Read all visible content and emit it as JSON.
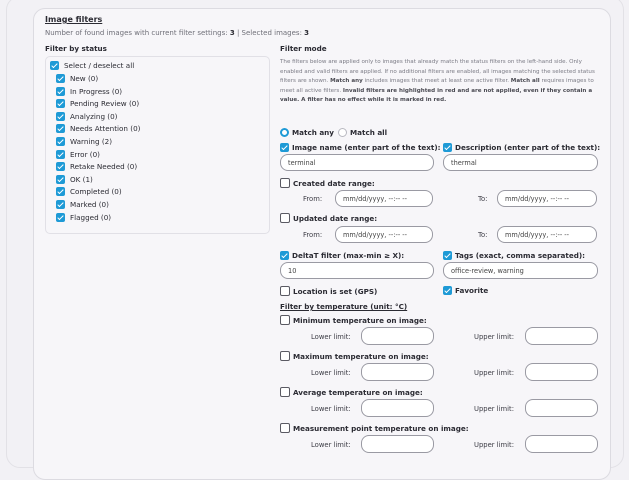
{
  "header": {
    "title": "Image filters",
    "summary_prefix": "Number of found images with current filter settings:",
    "found_count": "3",
    "summary_sep": "| Selected images:",
    "selected_count": "3"
  },
  "status": {
    "heading": "Filter by status",
    "select_all": "Select / deselect all",
    "items": [
      "New (0)",
      "In Progress (0)",
      "Pending Review (0)",
      "Analyzing (0)",
      "Needs Attention (0)",
      "Warning (2)",
      "Error (0)",
      "Retake Needed (0)",
      "OK (1)",
      "Completed (0)",
      "Marked (0)",
      "Flagged (0)"
    ]
  },
  "mode": {
    "heading": "Filter mode",
    "desc1": "The filters below are applied only to images that already match the status filters on the left-hand side. Only enabled and valid filters are applied. If no additional filters are enabled, all images matching the selected status filters are shown.",
    "desc_match_any": "Match any",
    "desc2": "includes images that meet at least one active filter.",
    "desc_match_all": "Match all",
    "desc3": "requires images to meet all active filters.",
    "desc4": "Invalid filters are highlighted in red and are not applied, even if they contain a value. A filter has no effect while it is marked in red.",
    "match_any": "Match any",
    "match_all": "Match all"
  },
  "filters": {
    "image_name_label": "Image name (enter part of the text):",
    "image_name_value": "terminal",
    "description_label": "Description (enter part of the text):",
    "description_value": "thermal",
    "created_label": "Created date range:",
    "updated_label": "Updated date range:",
    "from": "From:",
    "to": "To:",
    "date_placeholder": "mm/dd/yyyy, --:-- --",
    "deltat_label": "DeltaT filter (max-min ≥ X):",
    "deltat_value": "10",
    "tags_label": "Tags (exact, comma separated):",
    "tags_value": "office-review, warning",
    "location_label": "Location is set (GPS)",
    "favorite_label": "Favorite",
    "temp_heading": "Filter by temperature (unit: °C)",
    "min_label": "Minimum temperature on image:",
    "max_label": "Maximum temperature on image:",
    "avg_label": "Average temperature on image:",
    "mp_label": "Measurement point temperature on image:",
    "lower": "Lower limit:",
    "upper": "Upper limit:"
  }
}
